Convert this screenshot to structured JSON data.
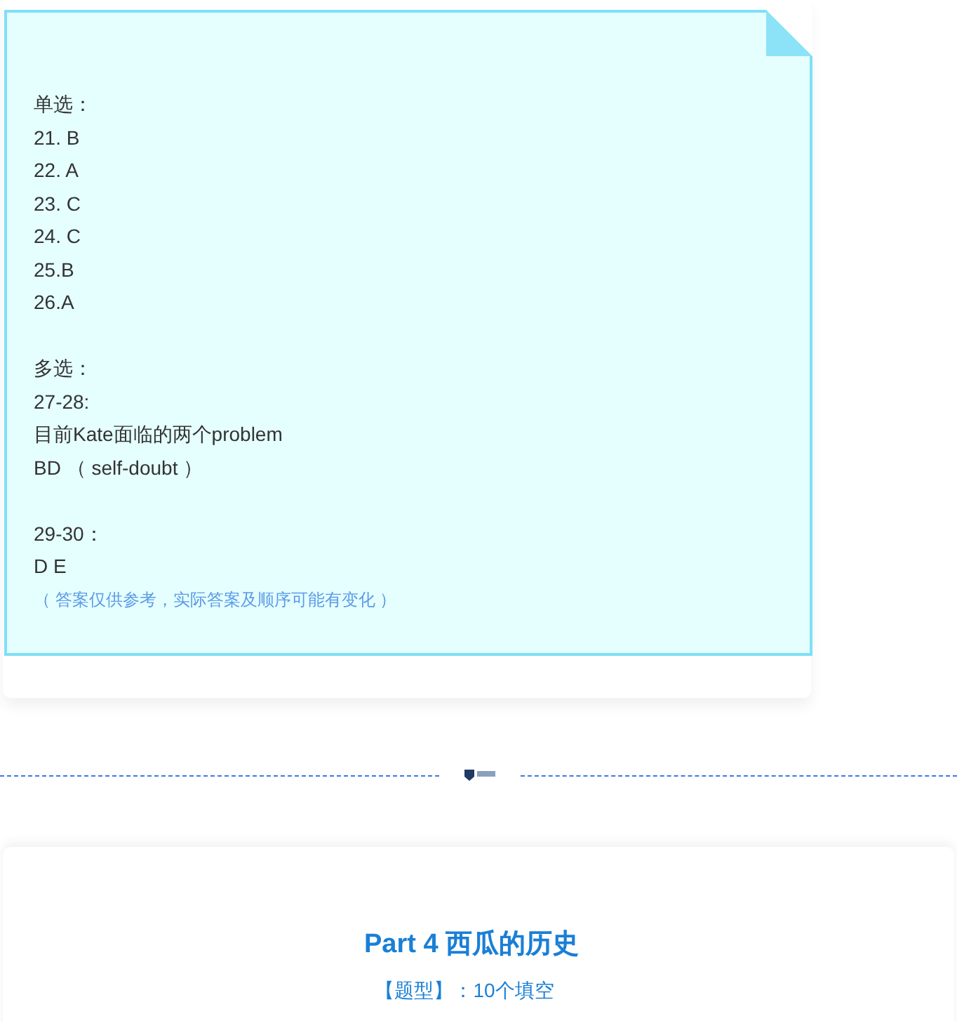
{
  "answer_note": {
    "groups": [
      {
        "lines": [
          "单选：",
          "21. B",
          "22. A",
          "23. C",
          "24. C",
          "25.B",
          "26.A"
        ]
      },
      {
        "lines": [
          "多选：",
          "27-28:",
          "目前Kate面临的两个problem",
          "BD （ self-doubt ）"
        ]
      },
      {
        "lines": [
          "29-30：",
          "D E"
        ]
      }
    ],
    "note": "（ 答案仅供参考，实际答案及顺序可能有变化 ）"
  },
  "section": {
    "title": "Part 4 西瓜的历史",
    "subtitle": "【题型】：10个填空"
  }
}
